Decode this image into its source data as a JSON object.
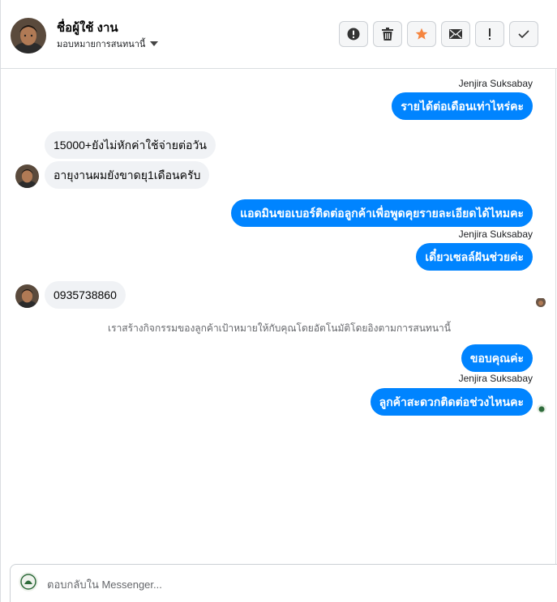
{
  "header": {
    "user_name": "ชื่อผู้ใช้ งาน",
    "assign_label": "มอบหมายการสนทนานี้",
    "buttons": [
      "spam-report",
      "delete",
      "star",
      "mark-unread",
      "important",
      "done"
    ]
  },
  "messages": [
    {
      "dir": "out",
      "sender": "Jenjira Suksabay",
      "text": "รายได้ต่อเดือนเท่าไหร่คะ"
    },
    {
      "dir": "in",
      "text": "15000+ยังไม่หักค่าใช้จ่ายต่อวัน"
    },
    {
      "dir": "in",
      "text": "อายุงานผมยังขาดยุ1เดือนครับ"
    },
    {
      "dir": "out",
      "text": "แอดมินขอเบอร์ติดต่อลูกค้าเพื่อพูดคุยรายละเอียดได้ไหมคะ"
    },
    {
      "dir": "out",
      "sender": "Jenjira Suksabay",
      "text": "เดี๋ยวเซลล์ฝันช่วยค่ะ"
    },
    {
      "dir": "in",
      "text": "0935738860"
    },
    {
      "dir": "out",
      "text": "ขอบคุณค่ะ"
    },
    {
      "dir": "out",
      "sender": "Jenjira Suksabay",
      "text": "ลูกค้าสะดวกติดต่อช่วงไหนคะ"
    }
  ],
  "system_note": "เราสร้างกิจกรรมของลูกค้าเป้าหมายให้กับคุณโดยอัตโนมัติโดยอิงตามการสนทนานี้",
  "composer": {
    "placeholder": "ตอบกลับใน Messenger..."
  },
  "colors": {
    "outgoing_bubble": "#0084ff",
    "incoming_bubble": "#f0f2f5",
    "star": "#f5853f"
  }
}
